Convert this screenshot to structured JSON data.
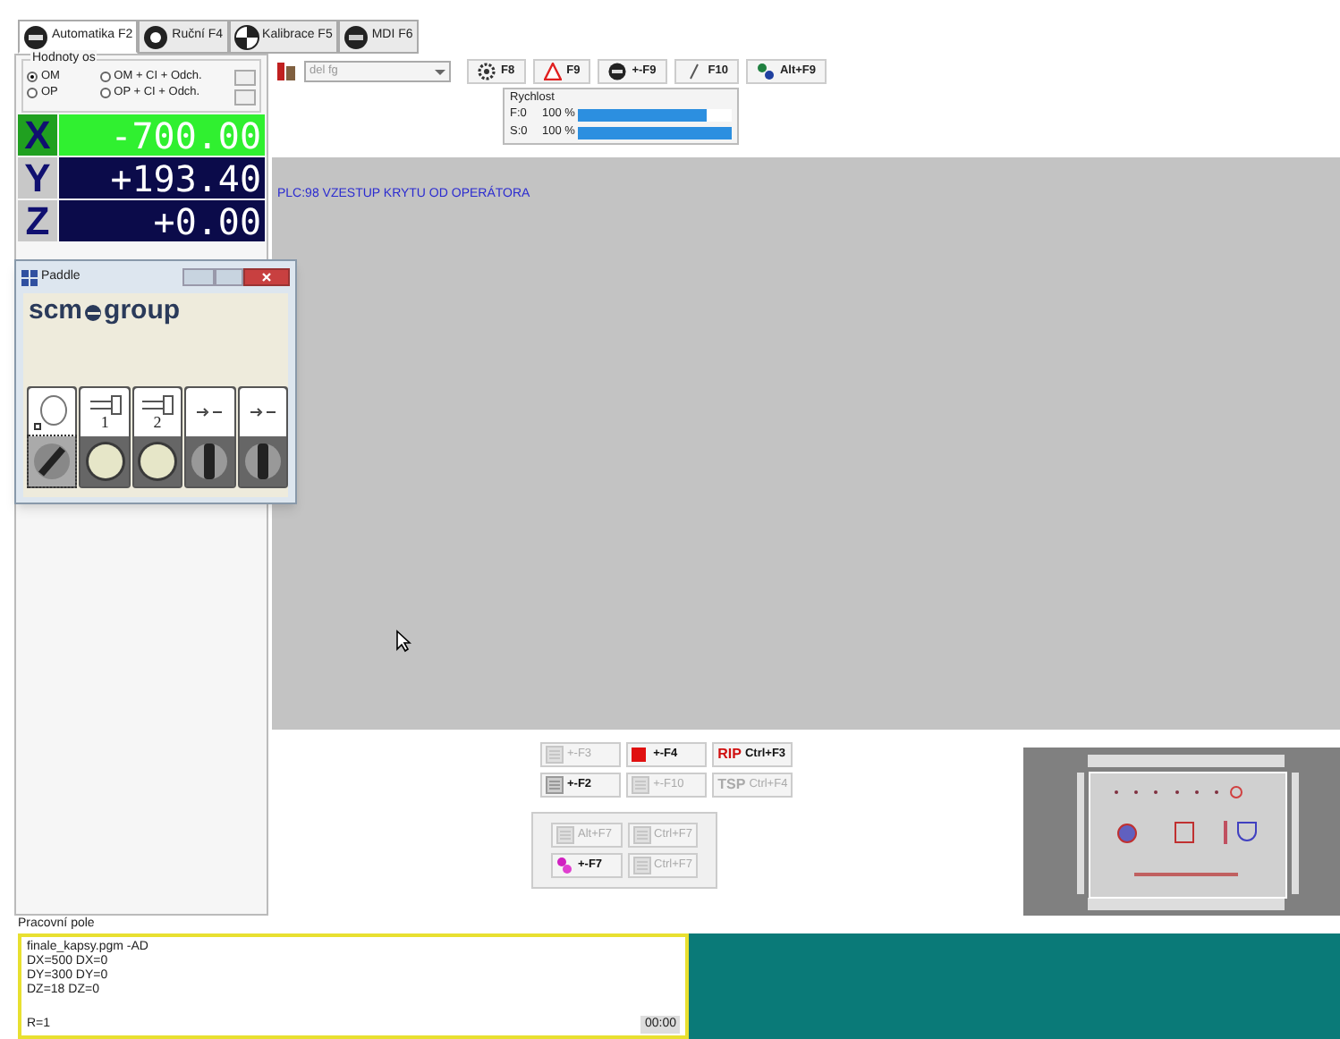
{
  "tabs": [
    {
      "label": "Automatika F2",
      "selected": true
    },
    {
      "label": "Ruční F4",
      "selected": false
    },
    {
      "label": "Kalibrace F5",
      "selected": false
    },
    {
      "label": "MDI F6",
      "selected": false
    }
  ],
  "axis_values": {
    "title": "Hodnoty os",
    "options": [
      {
        "label": "OM",
        "selected": true
      },
      {
        "label": "OM + CI + Odch.",
        "selected": false
      },
      {
        "label": "OP",
        "selected": false
      },
      {
        "label": "OP + CI + Odch.",
        "selected": false
      }
    ]
  },
  "axes": [
    {
      "letter": "X",
      "value": "-700.00",
      "selected": true
    },
    {
      "letter": "Y",
      "value": "+193.40",
      "selected": false
    },
    {
      "letter": "Z",
      "value": "+0.00",
      "selected": false
    }
  ],
  "toolbar": {
    "combo": "del fg",
    "buttons": [
      {
        "label": "F8"
      },
      {
        "label": "F9"
      },
      {
        "label": "+-F9"
      },
      {
        "label": "F10"
      },
      {
        "label": "Alt+F9"
      }
    ]
  },
  "speed": {
    "title": "Rychlost",
    "rows": [
      {
        "name": "F:0",
        "reading": "100 %",
        "level": 0.84
      },
      {
        "name": "S:0",
        "reading": "100 %",
        "level": 1.0
      }
    ]
  },
  "message": "PLC:98 VZESTUP KRYTU OD OPERÁTORA",
  "paddle": {
    "title": "Paddle",
    "logo_left": "scm",
    "logo_right": "group",
    "keys": [
      {
        "kind": "circle"
      },
      {
        "kind": "pin",
        "label": "1"
      },
      {
        "kind": "pin",
        "label": "2"
      },
      {
        "kind": "arrows"
      },
      {
        "kind": "arrows"
      }
    ],
    "controls": [
      {
        "kind": "selector"
      },
      {
        "kind": "lamp"
      },
      {
        "kind": "lamp"
      },
      {
        "kind": "switch"
      },
      {
        "kind": "switch"
      }
    ]
  },
  "commands": [
    {
      "label": "+-F3",
      "disabled": true
    },
    {
      "label": "+-F4",
      "disabled": false
    },
    {
      "prefix": "RIP",
      "label": "Ctrl+F3",
      "disabled": false
    },
    {
      "label": "+-F2",
      "disabled": false
    },
    {
      "label": "+-F10",
      "disabled": true
    },
    {
      "prefix": "TSP",
      "label": "Ctrl+F4",
      "disabled": true
    }
  ],
  "extra_commands": [
    {
      "label": "Alt+F7",
      "disabled": true
    },
    {
      "label": "Ctrl+F7",
      "disabled": true
    },
    {
      "label": "+-F7",
      "disabled": false
    },
    {
      "label": "Ctrl+F7",
      "disabled": true
    }
  ],
  "work_area": {
    "label": "Pracovní pole",
    "lines": [
      "finale_kapsy.pgm -AD",
      "DX=500 DX=0",
      "DY=300 DY=0",
      "DZ=18 DZ=0"
    ],
    "status": "R=1",
    "time": "00:00"
  }
}
